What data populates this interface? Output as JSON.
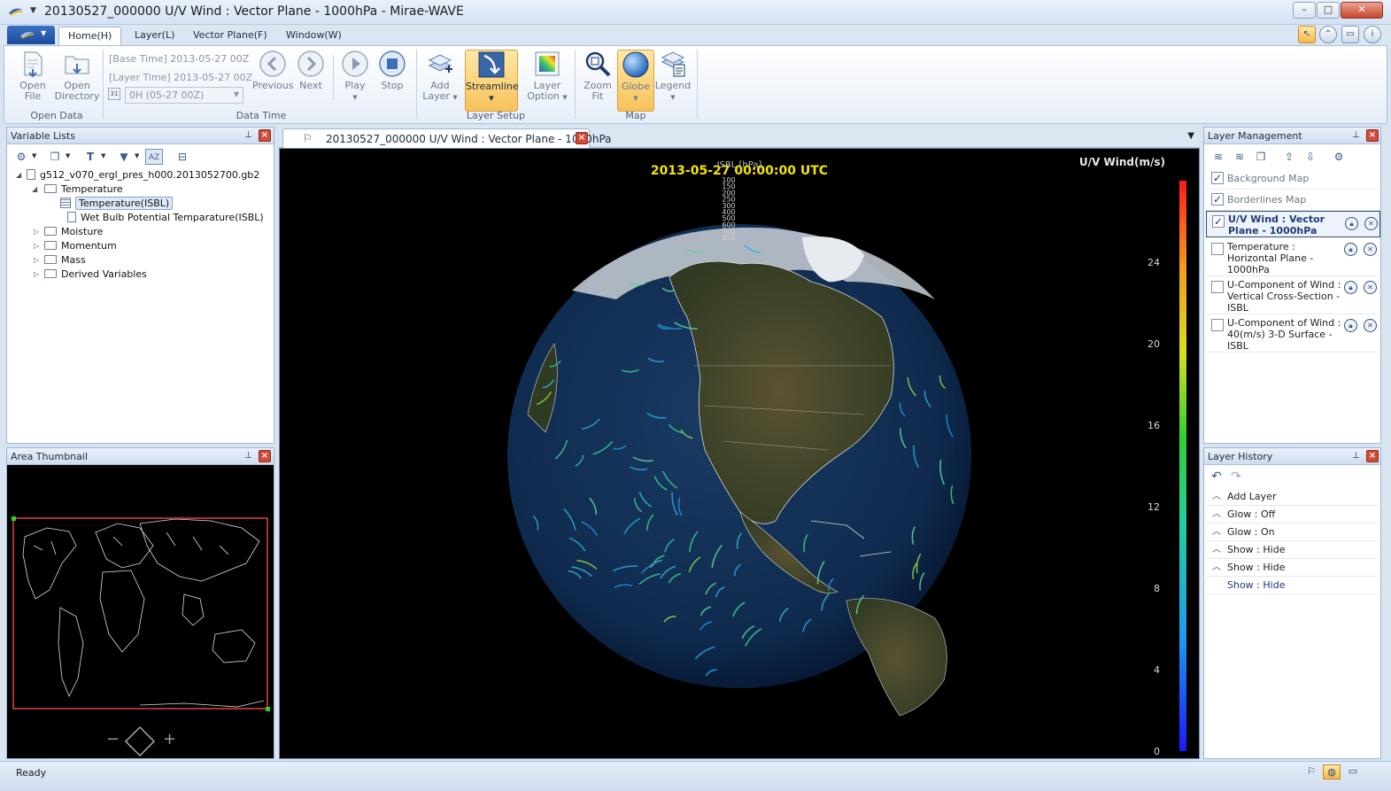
{
  "window": {
    "title": "20130527_000000 U/V Wind : Vector Plane - 1000hPa - Mirae-WAVE",
    "minimize": "–",
    "maximize": "□",
    "close": "✕"
  },
  "ribbon": {
    "tabs": [
      "Home(H)",
      "Layer(L)",
      "Vector Plane(F)",
      "Window(W)"
    ],
    "active_tab": "Home(H)",
    "open_data": {
      "open_file": [
        "Open",
        "File"
      ],
      "open_directory": [
        "Open",
        "Directory"
      ],
      "label": "Open Data"
    },
    "data_time": {
      "base_time": "[Base Time] 2013-05-27 00Z",
      "layer_time": "[Layer Time] 2013-05-27 00Z",
      "time_select": "0H (05-27 00Z)",
      "calendar_icon": "31",
      "previous": "Previous",
      "next": "Next",
      "play": "Play",
      "stop": "Stop",
      "label": "Data Time"
    },
    "layer_setup": {
      "add_layer": [
        "Add",
        "Layer"
      ],
      "streamline": "Streamline",
      "layer_option": [
        "Layer",
        "Option"
      ],
      "label": "Layer Setup"
    },
    "map": {
      "zoom_fit": [
        "Zoom",
        "Fit"
      ],
      "globe": "Globe",
      "legend": "Legend",
      "label": "Map"
    }
  },
  "variable_lists": {
    "title": "Variable Lists",
    "file": "g512_v070_ergl_pres_h000.2013052700.gb2",
    "folders": [
      {
        "name": "Temperature",
        "expanded": true,
        "children": [
          "Temperature(ISBL)",
          "Wet Bulb Potential Temparature(ISBL)"
        ],
        "selected_child": "Temperature(ISBL)"
      },
      {
        "name": "Moisture",
        "expanded": false
      },
      {
        "name": "Momentum",
        "expanded": false
      },
      {
        "name": "Mass",
        "expanded": false
      },
      {
        "name": "Derived Variables",
        "expanded": false
      }
    ]
  },
  "area_thumbnail": {
    "title": "Area Thumbnail",
    "zoom_out": "−",
    "zoom_in": "+"
  },
  "document": {
    "tab_title": "20130527_000000 U/V Wind : Vector Plane - 1000hPa",
    "timestamp": "2013-05-27 00:00:00 UTC",
    "isbl_label": "ISBL [hPa]",
    "isbl_levels": [
      "100",
      "150",
      "200",
      "250",
      "300",
      "400",
      "500",
      "600",
      "700",
      "850"
    ],
    "legend_title": "U/V Wind(m/s)",
    "legend_ticks": [
      {
        "value": 24,
        "label": "24"
      },
      {
        "value": 20,
        "label": "20"
      },
      {
        "value": 16,
        "label": "16"
      },
      {
        "value": 12,
        "label": "12"
      },
      {
        "value": 8,
        "label": "8"
      },
      {
        "value": 4,
        "label": "4"
      },
      {
        "value": 0,
        "label": "0"
      }
    ],
    "legend_max": 28,
    "colors": {
      "timestamp": "#f2e600",
      "ocean": "#0f2a4d",
      "land": "#3d3a26"
    }
  },
  "layer_management": {
    "title": "Layer Management",
    "layers": [
      {
        "label": "Background Map",
        "checked": true,
        "style": "muted",
        "controls": false
      },
      {
        "label": "Borderlines Map",
        "checked": true,
        "style": "muted",
        "controls": false
      },
      {
        "label": "U/V Wind : Vector Plane - 1000hPa",
        "checked": true,
        "style": "bold",
        "controls": true,
        "selected": true
      },
      {
        "label": "Temperature : Horizontal Plane - 1000hPa",
        "checked": false,
        "style": "normal",
        "controls": true
      },
      {
        "label": "U-Component of Wind : Vertical Cross-Section - ISBL",
        "checked": false,
        "style": "normal",
        "controls": true
      },
      {
        "label": "U-Component of Wind : 40(m/s) 3-D Surface - ISBL",
        "checked": false,
        "style": "normal",
        "controls": true
      }
    ]
  },
  "layer_history": {
    "title": "Layer History",
    "items": [
      {
        "label": "Add Layer",
        "current": false
      },
      {
        "label": "Glow : Off",
        "current": false
      },
      {
        "label": "Glow : On",
        "current": false
      },
      {
        "label": "Show : Hide",
        "current": false
      },
      {
        "label": "Show : Hide",
        "current": false
      },
      {
        "label": "Show : Hide",
        "current": true
      }
    ]
  },
  "status": {
    "text": "Ready"
  }
}
